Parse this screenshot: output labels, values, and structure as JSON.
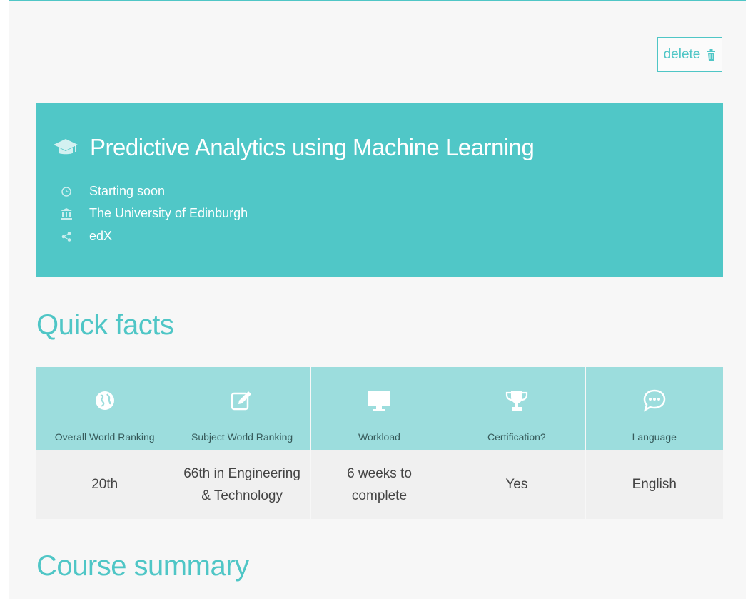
{
  "toolbar": {
    "delete_label": "delete"
  },
  "course": {
    "title": "Predictive Analytics using Machine Learning",
    "meta": [
      {
        "icon": "clock-icon",
        "text": "Starting soon"
      },
      {
        "icon": "institution-icon",
        "text": "The University of Edinburgh"
      },
      {
        "icon": "share-icon",
        "text": "edX"
      }
    ]
  },
  "quick_facts": {
    "title": "Quick facts",
    "items": [
      {
        "icon": "globe-icon",
        "label": "Overall World Ranking",
        "value": "20th"
      },
      {
        "icon": "edit-icon",
        "label": "Subject World Ranking",
        "value": "66th in Engineering & Technology"
      },
      {
        "icon": "monitor-icon",
        "label": "Workload",
        "value": "6 weeks to complete"
      },
      {
        "icon": "trophy-icon",
        "label": "Certification?",
        "value": "Yes"
      },
      {
        "icon": "chat-icon",
        "label": "Language",
        "value": "English"
      }
    ]
  },
  "course_summary": {
    "title": "Course summary"
  },
  "colors": {
    "accent": "#4fc6c6",
    "hero_bg": "#50c7c7",
    "facts_head_bg": "#9cdddd",
    "facts_body_bg": "#f0f0f0"
  }
}
